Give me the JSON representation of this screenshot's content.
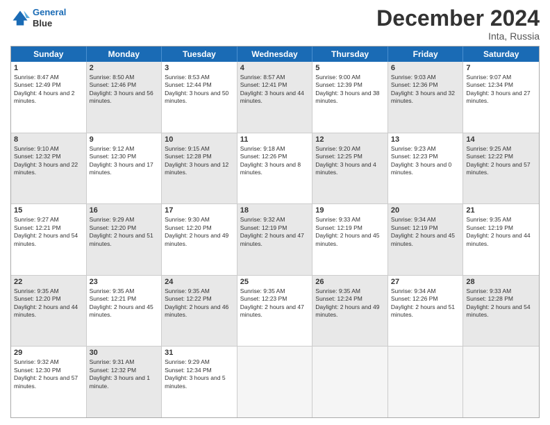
{
  "header": {
    "logo_line1": "General",
    "logo_line2": "Blue",
    "month": "December 2024",
    "location": "Inta, Russia"
  },
  "days_of_week": [
    "Sunday",
    "Monday",
    "Tuesday",
    "Wednesday",
    "Thursday",
    "Friday",
    "Saturday"
  ],
  "rows": [
    [
      {
        "day": "1",
        "sunrise": "Sunrise: 8:47 AM",
        "sunset": "Sunset: 12:49 PM",
        "daylight": "Daylight: 4 hours and 2 minutes.",
        "shaded": false
      },
      {
        "day": "2",
        "sunrise": "Sunrise: 8:50 AM",
        "sunset": "Sunset: 12:46 PM",
        "daylight": "Daylight: 3 hours and 56 minutes.",
        "shaded": true
      },
      {
        "day": "3",
        "sunrise": "Sunrise: 8:53 AM",
        "sunset": "Sunset: 12:44 PM",
        "daylight": "Daylight: 3 hours and 50 minutes.",
        "shaded": false
      },
      {
        "day": "4",
        "sunrise": "Sunrise: 8:57 AM",
        "sunset": "Sunset: 12:41 PM",
        "daylight": "Daylight: 3 hours and 44 minutes.",
        "shaded": true
      },
      {
        "day": "5",
        "sunrise": "Sunrise: 9:00 AM",
        "sunset": "Sunset: 12:39 PM",
        "daylight": "Daylight: 3 hours and 38 minutes.",
        "shaded": false
      },
      {
        "day": "6",
        "sunrise": "Sunrise: 9:03 AM",
        "sunset": "Sunset: 12:36 PM",
        "daylight": "Daylight: 3 hours and 32 minutes.",
        "shaded": true
      },
      {
        "day": "7",
        "sunrise": "Sunrise: 9:07 AM",
        "sunset": "Sunset: 12:34 PM",
        "daylight": "Daylight: 3 hours and 27 minutes.",
        "shaded": false
      }
    ],
    [
      {
        "day": "8",
        "sunrise": "Sunrise: 9:10 AM",
        "sunset": "Sunset: 12:32 PM",
        "daylight": "Daylight: 3 hours and 22 minutes.",
        "shaded": true
      },
      {
        "day": "9",
        "sunrise": "Sunrise: 9:12 AM",
        "sunset": "Sunset: 12:30 PM",
        "daylight": "Daylight: 3 hours and 17 minutes.",
        "shaded": false
      },
      {
        "day": "10",
        "sunrise": "Sunrise: 9:15 AM",
        "sunset": "Sunset: 12:28 PM",
        "daylight": "Daylight: 3 hours and 12 minutes.",
        "shaded": true
      },
      {
        "day": "11",
        "sunrise": "Sunrise: 9:18 AM",
        "sunset": "Sunset: 12:26 PM",
        "daylight": "Daylight: 3 hours and 8 minutes.",
        "shaded": false
      },
      {
        "day": "12",
        "sunrise": "Sunrise: 9:20 AM",
        "sunset": "Sunset: 12:25 PM",
        "daylight": "Daylight: 3 hours and 4 minutes.",
        "shaded": true
      },
      {
        "day": "13",
        "sunrise": "Sunrise: 9:23 AM",
        "sunset": "Sunset: 12:23 PM",
        "daylight": "Daylight: 3 hours and 0 minutes.",
        "shaded": false
      },
      {
        "day": "14",
        "sunrise": "Sunrise: 9:25 AM",
        "sunset": "Sunset: 12:22 PM",
        "daylight": "Daylight: 2 hours and 57 minutes.",
        "shaded": true
      }
    ],
    [
      {
        "day": "15",
        "sunrise": "Sunrise: 9:27 AM",
        "sunset": "Sunset: 12:21 PM",
        "daylight": "Daylight: 2 hours and 54 minutes.",
        "shaded": false
      },
      {
        "day": "16",
        "sunrise": "Sunrise: 9:29 AM",
        "sunset": "Sunset: 12:20 PM",
        "daylight": "Daylight: 2 hours and 51 minutes.",
        "shaded": true
      },
      {
        "day": "17",
        "sunrise": "Sunrise: 9:30 AM",
        "sunset": "Sunset: 12:20 PM",
        "daylight": "Daylight: 2 hours and 49 minutes.",
        "shaded": false
      },
      {
        "day": "18",
        "sunrise": "Sunrise: 9:32 AM",
        "sunset": "Sunset: 12:19 PM",
        "daylight": "Daylight: 2 hours and 47 minutes.",
        "shaded": true
      },
      {
        "day": "19",
        "sunrise": "Sunrise: 9:33 AM",
        "sunset": "Sunset: 12:19 PM",
        "daylight": "Daylight: 2 hours and 45 minutes.",
        "shaded": false
      },
      {
        "day": "20",
        "sunrise": "Sunrise: 9:34 AM",
        "sunset": "Sunset: 12:19 PM",
        "daylight": "Daylight: 2 hours and 45 minutes.",
        "shaded": true
      },
      {
        "day": "21",
        "sunrise": "Sunrise: 9:35 AM",
        "sunset": "Sunset: 12:19 PM",
        "daylight": "Daylight: 2 hours and 44 minutes.",
        "shaded": false
      }
    ],
    [
      {
        "day": "22",
        "sunrise": "Sunrise: 9:35 AM",
        "sunset": "Sunset: 12:20 PM",
        "daylight": "Daylight: 2 hours and 44 minutes.",
        "shaded": true
      },
      {
        "day": "23",
        "sunrise": "Sunrise: 9:35 AM",
        "sunset": "Sunset: 12:21 PM",
        "daylight": "Daylight: 2 hours and 45 minutes.",
        "shaded": false
      },
      {
        "day": "24",
        "sunrise": "Sunrise: 9:35 AM",
        "sunset": "Sunset: 12:22 PM",
        "daylight": "Daylight: 2 hours and 46 minutes.",
        "shaded": true
      },
      {
        "day": "25",
        "sunrise": "Sunrise: 9:35 AM",
        "sunset": "Sunset: 12:23 PM",
        "daylight": "Daylight: 2 hours and 47 minutes.",
        "shaded": false
      },
      {
        "day": "26",
        "sunrise": "Sunrise: 9:35 AM",
        "sunset": "Sunset: 12:24 PM",
        "daylight": "Daylight: 2 hours and 49 minutes.",
        "shaded": true
      },
      {
        "day": "27",
        "sunrise": "Sunrise: 9:34 AM",
        "sunset": "Sunset: 12:26 PM",
        "daylight": "Daylight: 2 hours and 51 minutes.",
        "shaded": false
      },
      {
        "day": "28",
        "sunrise": "Sunrise: 9:33 AM",
        "sunset": "Sunset: 12:28 PM",
        "daylight": "Daylight: 2 hours and 54 minutes.",
        "shaded": true
      }
    ],
    [
      {
        "day": "29",
        "sunrise": "Sunrise: 9:32 AM",
        "sunset": "Sunset: 12:30 PM",
        "daylight": "Daylight: 2 hours and 57 minutes.",
        "shaded": false
      },
      {
        "day": "30",
        "sunrise": "Sunrise: 9:31 AM",
        "sunset": "Sunset: 12:32 PM",
        "daylight": "Daylight: 3 hours and 1 minute.",
        "shaded": true
      },
      {
        "day": "31",
        "sunrise": "Sunrise: 9:29 AM",
        "sunset": "Sunset: 12:34 PM",
        "daylight": "Daylight: 3 hours and 5 minutes.",
        "shaded": false
      },
      {
        "day": "",
        "sunrise": "",
        "sunset": "",
        "daylight": "",
        "shaded": false,
        "empty": true
      },
      {
        "day": "",
        "sunrise": "",
        "sunset": "",
        "daylight": "",
        "shaded": true,
        "empty": true
      },
      {
        "day": "",
        "sunrise": "",
        "sunset": "",
        "daylight": "",
        "shaded": false,
        "empty": true
      },
      {
        "day": "",
        "sunrise": "",
        "sunset": "",
        "daylight": "",
        "shaded": true,
        "empty": true
      }
    ]
  ]
}
